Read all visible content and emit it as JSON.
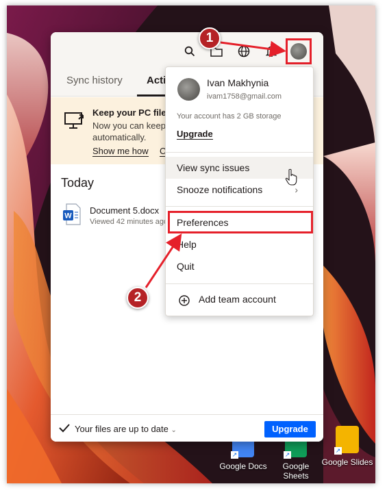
{
  "toolbar": {
    "icons": [
      "search-icon",
      "folder-icon",
      "globe-icon",
      "bell-icon",
      "avatar"
    ]
  },
  "tabs": [
    {
      "label": "Sync history"
    },
    {
      "label": "Acti"
    }
  ],
  "banner": {
    "title": "Keep your PC files",
    "text_line1": "Now you can keep",
    "text_line2": "automatically.",
    "show_me_how": "Show me how",
    "second_link": "C"
  },
  "activity": {
    "section_title": "Today",
    "doc_name": "Document 5.docx",
    "doc_time": "Viewed 42 minutes ago"
  },
  "footer": {
    "status": "Your files are up to date",
    "upgrade": "Upgrade"
  },
  "menu": {
    "user_name": "Ivan Makhynia",
    "user_email": "ivam1758@gmail.com",
    "storage": "Your account has 2 GB storage",
    "upgrade": "Upgrade",
    "items": [
      {
        "label": "View sync issues"
      },
      {
        "label": "Snooze notifications"
      },
      {
        "label": "Preferences"
      },
      {
        "label": "Help"
      },
      {
        "label": "Quit"
      }
    ],
    "add_team": "Add team account"
  },
  "annotations": {
    "badge1": "1",
    "badge2": "2",
    "highlight_color": "#e5202a",
    "badge_color": "#b52226"
  },
  "desktop": {
    "icons": [
      {
        "label": "Google Docs",
        "icon": "google-docs-icon",
        "color": "#4285f4"
      },
      {
        "label_line1": "Google",
        "label_line2": "Sheets",
        "icon": "google-sheets-icon",
        "color": "#0f9d58"
      },
      {
        "label": "Google Slides",
        "icon": "google-slides-icon",
        "color": "#f4b400"
      }
    ]
  },
  "colors": {
    "accent": "#0061fe",
    "banner_bg": "#fcf1de"
  }
}
